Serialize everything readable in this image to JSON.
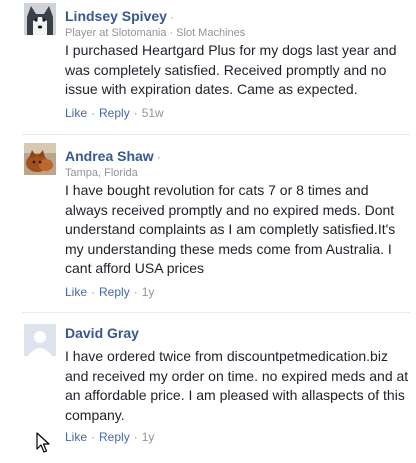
{
  "comments": [
    {
      "author": "Lindsey Spivey",
      "subtitle_parts": [
        "Player at Slotomania",
        "Slot Machines"
      ],
      "body": "I purchased Heartgard Plus for my dogs last year and was completely satisfied. Received promptly and no issue with expiration dates. Came as expected.",
      "like_label": "Like",
      "reply_label": "Reply",
      "time": "51w",
      "avatar": "husky-avatar"
    },
    {
      "author": "Andrea Shaw",
      "subtitle_parts": [
        "Tampa, Florida"
      ],
      "body": "I have bought revolution for cats 7 or 8 times and always received promptly and no expired meds. Dont understand complaints as I am completly satisfied.It's my understanding these meds come from Australia. I cant afford USA prices",
      "like_label": "Like",
      "reply_label": "Reply",
      "time": "1y",
      "avatar": "cat-avatar"
    },
    {
      "author": "David Gray",
      "subtitle_parts": [],
      "body": "I have ordered twice from discountpetmedication.biz and received my order on time. no expired meds and at an affordable price. I am pleased with allaspects of this company.",
      "like_label": "Like",
      "reply_label": "Reply",
      "time": "1y",
      "avatar": "default-avatar"
    }
  ],
  "separator_dot": "·",
  "colors": {
    "link": "#4267b2",
    "name": "#365899",
    "meta": "#90949c",
    "text": "#1d2129"
  }
}
